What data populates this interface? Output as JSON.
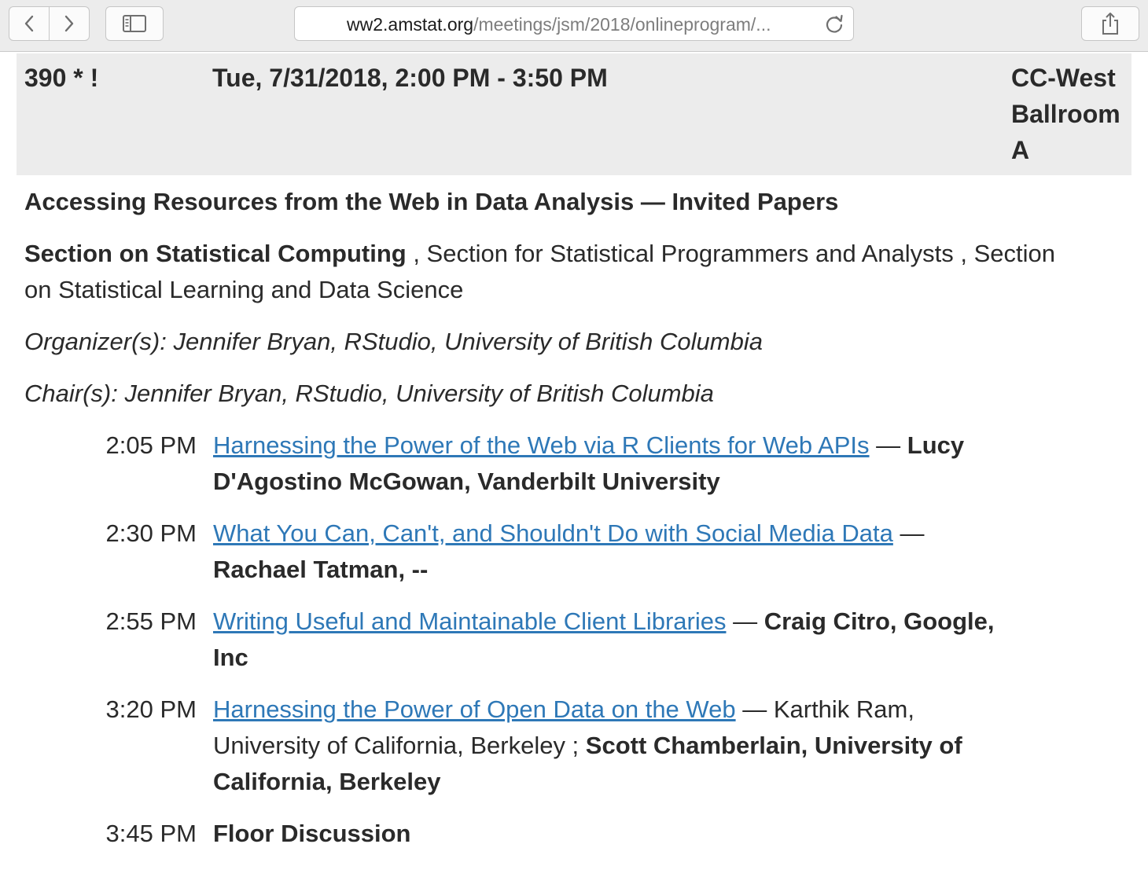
{
  "browser": {
    "url_domain": "ww2.amstat.org",
    "url_path": "/meetings/jsm/2018/onlineprogram/..."
  },
  "session": {
    "number": "390 * !",
    "datetime": "Tue, 7/31/2018, 2:00 PM - 3:50 PM",
    "location": "CC-West Ballroom A",
    "title": "Accessing Resources from the Web in Data Analysis — Invited Papers",
    "sponsor_main": "Section on Statistical Computing",
    "sponsor_rest": " , Section for Statistical Programmers and Analysts , Section on Statistical Learning and Data Science",
    "organizer": "Organizer(s): Jennifer Bryan, RStudio, University of British Columbia",
    "chair": "Chair(s): Jennifer Bryan, RStudio, University of British Columbia"
  },
  "talks": [
    {
      "time": "2:05 PM",
      "title": "Harnessing the Power of the Web via R Clients for Web APIs",
      "sep": " — ",
      "authors_plain": "",
      "authors_bold": "Lucy D'Agostino McGowan, Vanderbilt University"
    },
    {
      "time": "2:30 PM",
      "title": "What You Can, Can't, and Shouldn't Do with Social Media Data",
      "sep": " — ",
      "authors_plain": "",
      "authors_bold": "Rachael Tatman, --"
    },
    {
      "time": "2:55 PM",
      "title": "Writing Useful and Maintainable Client Libraries",
      "sep": " — ",
      "authors_plain": "",
      "authors_bold": "Craig Citro, Google, Inc"
    },
    {
      "time": "3:20 PM",
      "title": "Harnessing the Power of Open Data on the Web",
      "sep": " — ",
      "authors_plain": "Karthik Ram, University of California, Berkeley ; ",
      "authors_bold": "Scott Chamberlain, University of California, Berkeley"
    },
    {
      "time": "3:45 PM",
      "label": "Floor Discussion"
    }
  ],
  "icons": {
    "back": "chevron-left-icon",
    "forward": "chevron-right-icon",
    "sidebar": "sidebar-icon",
    "reload": "reload-icon",
    "share": "share-icon"
  },
  "colors": {
    "link": "#2e78b7",
    "header_bg": "#ececec",
    "toolbar_bg": "#ececec"
  }
}
